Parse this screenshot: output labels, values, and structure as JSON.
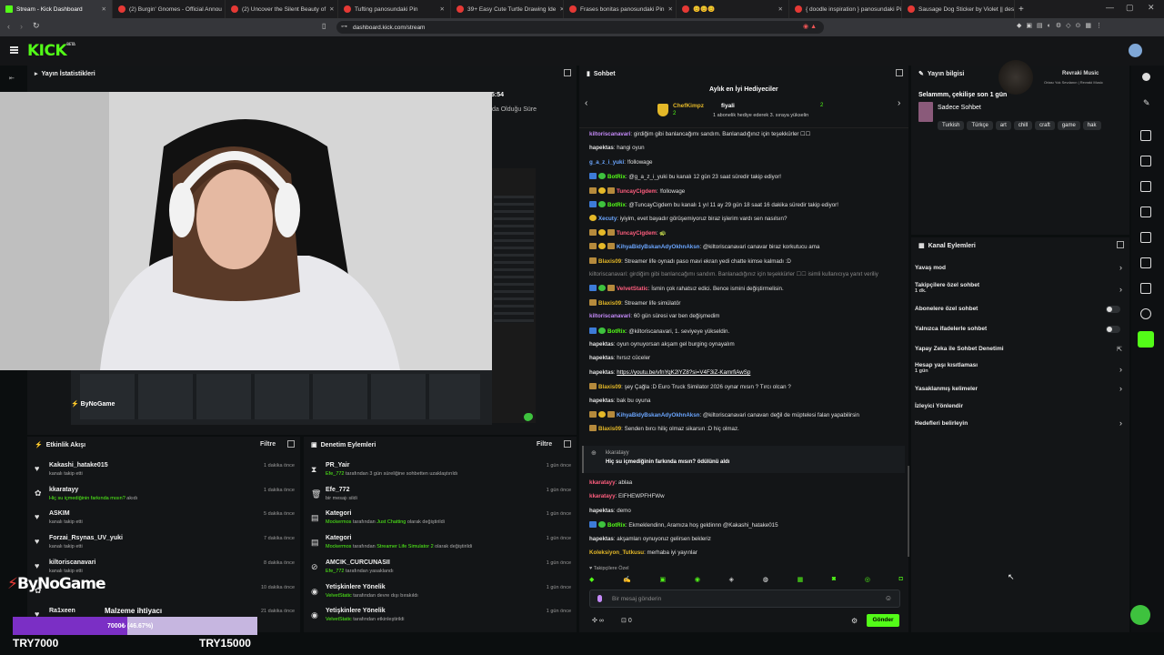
{
  "browser": {
    "tabs": [
      {
        "title": "Stream - Kick Dashboard",
        "active": true
      },
      {
        "title": "(2) Burgin' Gnomes - Official Annou"
      },
      {
        "title": "(2) Uncover the Silent Beauty of"
      },
      {
        "title": "Tufting panosundaki Pin"
      },
      {
        "title": "39+ Easy Cute Turtle Drawing Ide"
      },
      {
        "title": "Frases bonitas panosundaki Pin"
      },
      {
        "title": "😊😊😊"
      },
      {
        "title": "{ doodle inspiration } panosundaki Pi"
      },
      {
        "title": "Sausage Dog Sticker by Violet || desi"
      }
    ],
    "url": "dashboard.kick.com/stream"
  },
  "header": {
    "logo": "KICK",
    "logo_sup": "BETA"
  },
  "stats": {
    "title": "Yayın İstatistikleri",
    "value": "5:54",
    "label": "da Olduğu Süre"
  },
  "activity": {
    "title": "Etkinlik Akışı",
    "filter": "Filtre",
    "items": [
      {
        "name": "Kakashi_hatake015",
        "sub": "kanalı takip etti",
        "time": "1 dakika önce",
        "icon": "heart-icon"
      },
      {
        "name": "kkaratayy",
        "sub": "Hiç su içmediğinin farkında mısın?",
        "sub2": "akıdı",
        "time": "1 dakika önce",
        "icon": "gift-icon"
      },
      {
        "name": "ASKIM",
        "sub": "kanalı takip etti",
        "time": "5 dakika önce",
        "icon": "heart-icon"
      },
      {
        "name": "Forzai_Rsynas_UV_yuki",
        "sub": "kanalı takip etti",
        "time": "7 dakika önce",
        "icon": "heart-icon"
      },
      {
        "name": "kiltoriscanavari",
        "sub": "kanalı takip etti",
        "time": "8 dakika önce",
        "icon": "heart-icon"
      },
      {
        "name": "",
        "sub": "",
        "time": "10 dakika önce",
        "icon": "gift-icon"
      },
      {
        "name": "Ra1xeen",
        "sub": "",
        "time": "21 dakika önce",
        "icon": "heart-icon"
      }
    ]
  },
  "moderation": {
    "title": "Denetim Eylemleri",
    "filter": "Filtre",
    "items": [
      {
        "name": "PR_Yair",
        "actor": "Efe_772",
        "text": "tarafından 3 gün süreliğine sohbetten uzaklaştırıldı",
        "time": "1 gün önce",
        "icon": "hourglass-icon"
      },
      {
        "name": "Efe_772",
        "actor": "",
        "text": "bir mesajı sildi",
        "time": "1 gün önce",
        "icon": "trash-icon"
      },
      {
        "name": "Kategori",
        "actor": "Mockermos",
        "text": "tarafından",
        "hl": "Just Chatting",
        "tail": "olarak değiştirildi",
        "time": "1 gün önce",
        "icon": "doc-icon"
      },
      {
        "name": "Kategori",
        "actor": "Mockermos",
        "text": "tarafından",
        "hl": "Streamer Life Simulator 2",
        "tail": "olarak değiştirildi",
        "time": "1 gün önce",
        "icon": "doc-icon"
      },
      {
        "name": "AMCIK_CURCUNASII",
        "actor": "Efe_772",
        "text": "tarafından yasaklandı",
        "time": "1 gün önce",
        "icon": "ban-icon"
      },
      {
        "name": "Yetişkinlere Yönelik",
        "actor": "VelvetStatic",
        "text": "tarafından devre dışı bırakıldı",
        "time": "1 gün önce",
        "icon": "eye-icon"
      },
      {
        "name": "Yetişkinlere Yönelik",
        "actor": "VelvetStatic",
        "text": "tarafından etkinleştirildi",
        "time": "1 gün önce",
        "icon": "eye-icon"
      }
    ]
  },
  "overlay": {
    "brand": "ByNoGame",
    "goal_label": "Malzeme ihtiyacı",
    "goal_progress_text": "7000₺ (46.67%)",
    "goal_progress": 0.4667,
    "goal_start": "TRY7000",
    "goal_end": "TRY15000"
  },
  "chat": {
    "title": "Sohbet",
    "leaderboard_title": "Aylık en İyi Hediyeciler",
    "top1": "ChefKimpz",
    "top1_count": "2",
    "top2": "fiyali",
    "top2_count": "2",
    "top_hint": "1 abonelik hediye ederek 3. sıraya yükselin",
    "messages": [
      {
        "user": "kiltoriscanavari",
        "color": "#c58af9",
        "text": "girdiğim gibi banlancağımı sandım. Banlanadığınız için teşekkürler ☐☐"
      },
      {
        "user": "hapektas",
        "color": "#e0e0e0",
        "text": "hangi oyun"
      },
      {
        "user": "g_a_z_i_yuki",
        "color": "#6ba6ff",
        "text": "!followage"
      },
      {
        "user": "BotRix",
        "color": "#53fc18",
        "text": "@g_a_z_i_yuki bu kanalı 12 gün 23 saat süredir takip ediyor!",
        "badges": [
          "blue",
          "green"
        ]
      },
      {
        "user": "TuncayCigdem",
        "color": "#ff5e7e",
        "text": "!followage",
        "badges": [
          "brown",
          "yel",
          "brown"
        ]
      },
      {
        "user": "BotRix",
        "color": "#53fc18",
        "text": "@TuncayCigdem bu kanalı 1 yıl 11 ay 29 gün 18 saat 16 dakika süredir takip ediyor!",
        "badges": [
          "blue",
          "green"
        ]
      },
      {
        "user": "Xecuty",
        "color": "#6ba6ff",
        "text": "iyiyim, evet bayadır görüşemiyoruz biraz işlerim vardı sen nasılsın?",
        "badges": [
          "yel"
        ]
      },
      {
        "user": "TuncayCigdem",
        "color": "#ff5e7e",
        "text": "🐢",
        "badges": [
          "brown",
          "yel",
          "brown"
        ]
      },
      {
        "user": "KihyaBidyBskanAdyOkhnAksn",
        "color": "#6ba6ff",
        "text": "@kiltoriscanavari canavar biraz korkutucu ama",
        "badges": [
          "brown",
          "yel",
          "brown"
        ]
      },
      {
        "user": "Blaxis09",
        "color": "#e4b828",
        "text": "Streamer life oynadı paso mavi ekran yedi chatte kimse kalmadı :D",
        "badges": [
          "brown"
        ]
      },
      {
        "user": "",
        "color": "#888",
        "text": "kiltoriscanavari: girdiğim gibi banlancağımı sandım. Banlanadığınız için teşekkürler ☐☐ isimli kullanıcıya yanıt veriliy",
        "reply": true
      },
      {
        "user": "VelvetStatic",
        "color": "#ff5e7e",
        "text": "İsmin çok rahatsız edici. Bence ismini değiştirmelisin.",
        "badges": [
          "blue",
          "green",
          "brown"
        ]
      },
      {
        "user": "Blaxis09",
        "color": "#e4b828",
        "text": "Streamer life simülatör",
        "badges": [
          "brown"
        ]
      },
      {
        "user": "kiltoriscanavari",
        "color": "#c58af9",
        "text": "60 gün süresi var ben değişmedim"
      },
      {
        "user": "BotRix",
        "color": "#53fc18",
        "text": "@kiltoriscanavari, 1. seviyeye yükseldin.",
        "badges": [
          "blue",
          "green"
        ]
      },
      {
        "user": "hapektas",
        "color": "#e0e0e0",
        "text": "oyun oynuyorsan akşam gel burging oynayalım"
      },
      {
        "user": "hapektas",
        "color": "#e0e0e0",
        "text": "hırsız cüceler"
      },
      {
        "user": "hapektas",
        "color": "#e0e0e0",
        "text": "https://youtu.be/vfnYqK2lYZ8?si=V4F3iZ-KamrfiAwSp",
        "link": true
      },
      {
        "user": "Blaxis09",
        "color": "#e4b828",
        "text": "şey Çağla :D Euro Truck Similator 2026 oynar mısın ? Tırcı olcan ?",
        "badges": [
          "brown"
        ]
      },
      {
        "user": "hapektas",
        "color": "#e0e0e0",
        "text": "bak bu oyuna"
      },
      {
        "user": "KihyaBidyBskanAdyOkhnAksn",
        "color": "#6ba6ff",
        "text": "@kiltoriscanavari canavarı değil de müptelesi falan yapabilirsin",
        "badges": [
          "brown",
          "yel",
          "brown"
        ]
      },
      {
        "user": "Blaxis09",
        "color": "#e4b828",
        "text": "Senden bırcı hiliç olmaz sikarsın :D hiç olmaz.",
        "badges": [
          "brown"
        ]
      }
    ],
    "gift_card": {
      "user": "kkaratayy",
      "text": "Hiç su içmediğinin farkında mısın? ödülünü aldı"
    },
    "messages2": [
      {
        "user": "kkaratayy",
        "color": "#ff5e7e",
        "text": "ablaa"
      },
      {
        "user": "kkaratayy",
        "color": "#ff5e7e",
        "text": "EIFHEWPFHFWw"
      },
      {
        "user": "hapektas",
        "color": "#e0e0e0",
        "text": "demo"
      },
      {
        "user": "BotRix",
        "color": "#53fc18",
        "text": "Ekmeklendinn, Aramıza hoş geldinnn @Kakashi_hatake015",
        "badges": [
          "blue",
          "green"
        ]
      },
      {
        "user": "hapektas",
        "color": "#e0e0e0",
        "text": "akşamları oynuyoruz gelirsen bekleriz"
      },
      {
        "user": "Koleksiyon_Tutkusu",
        "color": "#e4b828",
        "text": "merhaba iyi yayınlar"
      }
    ],
    "followers_only": "Takipçilere Özel",
    "input_placeholder": "Bir mesaj gönderin",
    "count_a": "∞",
    "count_b": "0",
    "send": "Gönder"
  },
  "stream_info": {
    "title": "Yayın bilgisi",
    "stream_title": "Selammm, çekilişe son 1 gün",
    "category": "Sadece Sohbet",
    "tags": [
      "Turkish",
      "Türkçe",
      "art",
      "chill",
      "craft",
      "game",
      "hak"
    ],
    "music_title": "Revraki Music",
    "music_sub": "Ortası Yok Sevdanın | Revraki Music"
  },
  "channel_actions": {
    "title": "Kanal Eylemleri",
    "items": [
      {
        "label": "Yavaş mod",
        "kind": "chevron"
      },
      {
        "label": "Takipçilere özel sohbet",
        "sub": "1 dk.",
        "kind": "chevron"
      },
      {
        "label": "Abonelere özel sohbet",
        "kind": "toggle"
      },
      {
        "label": "Yalnızca ifadelerle sohbet",
        "kind": "toggle"
      },
      {
        "label": "Yapay Zeka ile Sohbet Denetimi",
        "kind": "external"
      },
      {
        "label": "Hesap yaşı kısıtlaması",
        "sub": "1 gün",
        "kind": "chevron"
      },
      {
        "label": "Yasaklanmış kelimeler",
        "kind": "chevron"
      },
      {
        "label": "İzleyici Yönlendir",
        "kind": "none"
      },
      {
        "label": "Hedefleri belirleyin",
        "kind": "chevron"
      }
    ]
  }
}
